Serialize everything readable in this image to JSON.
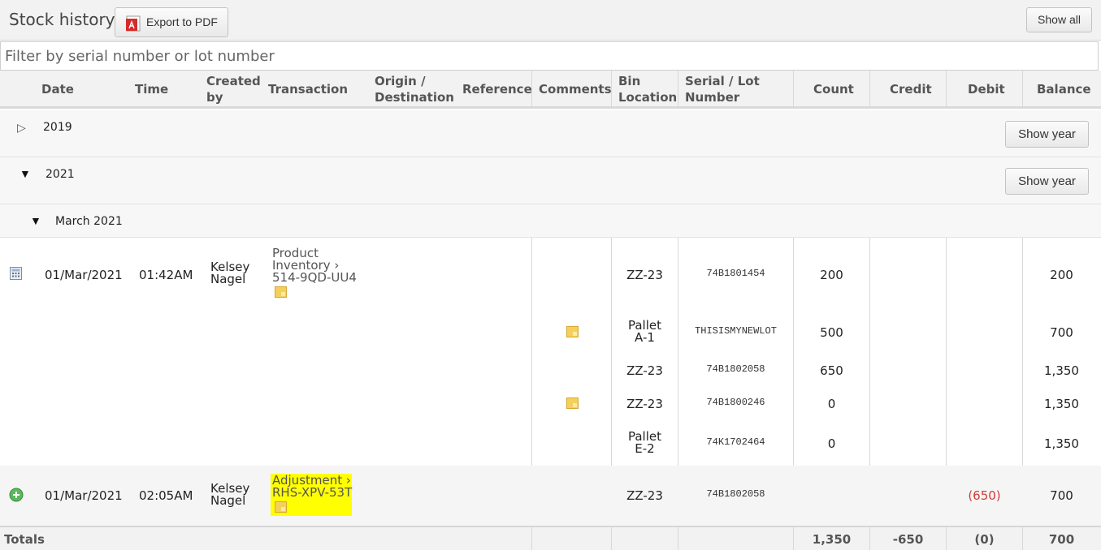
{
  "header": {
    "title": "Stock history",
    "export_label": "Export to PDF",
    "show_all_label": "Show all"
  },
  "filter": {
    "placeholder": "Filter by serial number or lot number",
    "value": ""
  },
  "columns": {
    "date": "Date",
    "time": "Time",
    "created_by": "Created by",
    "transaction": "Transaction",
    "origin": "Origin / Destination",
    "reference": "Reference",
    "comments": "Comments",
    "bin": "Bin Location",
    "serial": "Serial / Lot Number",
    "count": "Count",
    "credit": "Credit",
    "debit": "Debit",
    "balance": "Balance"
  },
  "years": [
    {
      "year": "2019",
      "expanded": false,
      "button": "Show year"
    },
    {
      "year": "2021",
      "expanded": true,
      "button": "Show year"
    }
  ],
  "month": {
    "label": "March 2021",
    "expanded": true
  },
  "transactions": [
    {
      "icon": "calculator-icon",
      "date": "01/Mar/2021",
      "time": "01:42AM",
      "created_by": "Kelsey Nagel",
      "transaction_line1": "Product",
      "transaction_line2": "Inventory ›",
      "transaction_line3": "514-9QD-UU4",
      "lines": [
        {
          "comment": false,
          "bin": "ZZ-23",
          "serial": "74B1801454",
          "count": "200",
          "balance": "200"
        },
        {
          "comment": true,
          "bin": "Pallet A-1",
          "serial": "THISISMYNEWLOT",
          "count": "500",
          "balance": "700"
        },
        {
          "comment": false,
          "bin": "ZZ-23",
          "serial": "74B1802058",
          "count": "650",
          "balance": "1,350"
        },
        {
          "comment": true,
          "bin": "ZZ-23",
          "serial": "74B1800246",
          "count": "0",
          "balance": "1,350"
        },
        {
          "comment": false,
          "bin": "Pallet E-2",
          "serial": "74K1702464",
          "count": "0",
          "balance": "1,350"
        }
      ]
    },
    {
      "icon": "plus-circle-icon",
      "date": "01/Mar/2021",
      "time": "02:05AM",
      "created_by": "Kelsey Nagel",
      "transaction_line1": "Adjustment ›",
      "transaction_line2": "RHS-XPV-53T",
      "bin": "ZZ-23",
      "serial": "74B1802058",
      "debit": "(650)",
      "balance": "700"
    }
  ],
  "totals": {
    "label": "Totals",
    "count": "1,350",
    "credit": "-650",
    "debit": "(0)",
    "balance": "700"
  },
  "colors": {
    "debit_red": "#d23a3a",
    "highlight": "#ffff00"
  }
}
